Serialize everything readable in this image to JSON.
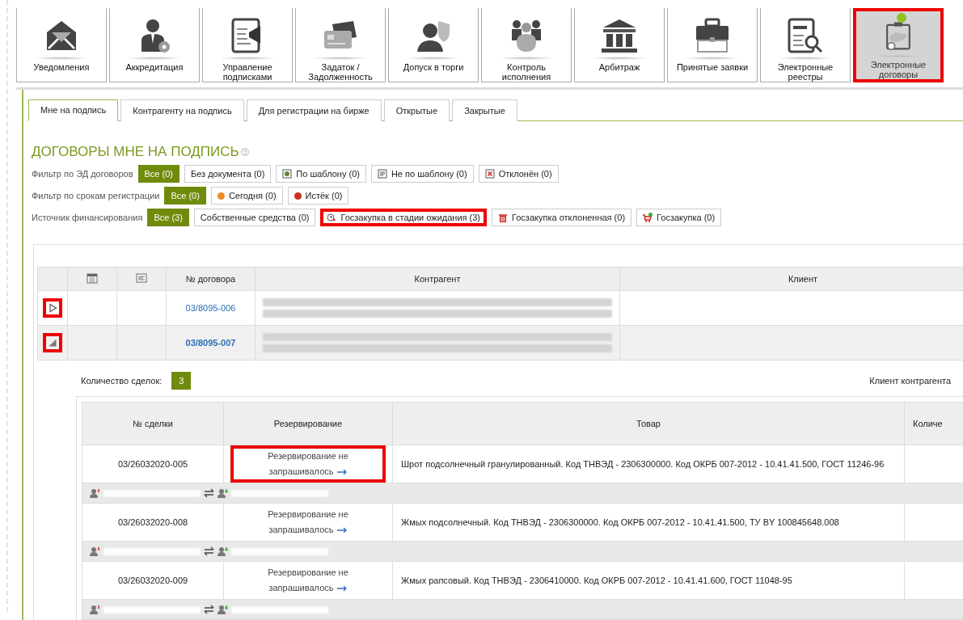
{
  "nav": [
    {
      "label": "Уведомления",
      "selected": false,
      "highlighted": false
    },
    {
      "label": "Аккредитация",
      "selected": false,
      "highlighted": false
    },
    {
      "label": "Управление подписками",
      "selected": false,
      "highlighted": false
    },
    {
      "label": "Задаток / Задолженность",
      "selected": false,
      "highlighted": false
    },
    {
      "label": "Допуск в торги",
      "selected": false,
      "highlighted": false
    },
    {
      "label": "Контроль исполнения",
      "selected": false,
      "highlighted": false
    },
    {
      "label": "Арбитраж",
      "selected": false,
      "highlighted": false
    },
    {
      "label": "Принятые заявки",
      "selected": false,
      "highlighted": false
    },
    {
      "label": "Электронные реестры",
      "selected": false,
      "highlighted": false
    },
    {
      "label": "Электронные договоры",
      "selected": true,
      "highlighted": true
    }
  ],
  "tabs": [
    {
      "label": "Мне на подпись",
      "selected": true
    },
    {
      "label": "Контрагенту на подпись",
      "selected": false
    },
    {
      "label": "Для регистрации на бирже",
      "selected": false
    },
    {
      "label": "Открытые",
      "selected": false
    },
    {
      "label": "Закрытые",
      "selected": false
    }
  ],
  "heading": "ДОГОВОРЫ МНЕ НА ПОДПИСЬ",
  "filters": [
    {
      "label": "Фильтр по ЭД договоров",
      "options": [
        {
          "label": "Все (0)",
          "selected": true,
          "kind": "plain",
          "highlighted": false
        },
        {
          "label": "Без документа (0)",
          "selected": false,
          "kind": "plain",
          "highlighted": false
        },
        {
          "label": "По шаблону (0)",
          "selected": false,
          "kind": "template",
          "highlighted": false
        },
        {
          "label": "Не по шаблону (0)",
          "selected": false,
          "kind": "document",
          "highlighted": false
        },
        {
          "label": "Отклонён (0)",
          "selected": false,
          "kind": "rejected",
          "highlighted": false
        }
      ]
    },
    {
      "label": "Фильтр по срокам регистрации",
      "options": [
        {
          "label": "Все (0)",
          "selected": true,
          "kind": "plain",
          "highlighted": false
        },
        {
          "label": "Сегодня (0)",
          "selected": false,
          "kind": "status",
          "color": "#f08a24",
          "highlighted": false
        },
        {
          "label": "Истёк (0)",
          "selected": false,
          "kind": "status",
          "color": "#c9341e",
          "highlighted": false
        }
      ]
    },
    {
      "label": "Источник финансирования",
      "options": [
        {
          "label": "Все (3)",
          "selected": true,
          "kind": "plain",
          "highlighted": false
        },
        {
          "label": "Собственные средства (0)",
          "selected": false,
          "kind": "plain",
          "highlighted": false
        },
        {
          "label": "Госзакупка в стадии ожидания (3)",
          "selected": false,
          "kind": "pending",
          "highlighted": true
        },
        {
          "label": "Госзакупка отклоненная (0)",
          "selected": false,
          "kind": "declined",
          "highlighted": false
        },
        {
          "label": "Госзакупка (0)",
          "selected": false,
          "kind": "purchase",
          "highlighted": false
        }
      ]
    }
  ],
  "contracts": {
    "columns": [
      {
        "kind": "blank"
      },
      {
        "kind": "calendar"
      },
      {
        "kind": "doc"
      },
      {
        "kind": "text",
        "label": "№ договора"
      },
      {
        "kind": "text",
        "label": "Контрагент"
      },
      {
        "kind": "text",
        "label": "Клиент"
      }
    ],
    "rows": [
      {
        "number": "03/8095-006",
        "expanded": false,
        "highlighted": true
      },
      {
        "number": "03/8095-007",
        "expanded": true,
        "highlighted": true
      }
    ]
  },
  "deals": {
    "count_label": "Количество сделок:",
    "count": "3",
    "client_label": "Клиент контрагента",
    "columns": [
      "№ сделки",
      "Резервирование",
      "Товар",
      "Количе"
    ],
    "rows": [
      {
        "number": "03/26032020-005",
        "reservation": "Резервирование не запрашивалось",
        "highlighted": true,
        "product": "Шрот подсолнечный гранулированный. Код ТНВЭД - 2306300000. Код ОКРБ 007-2012 - 10.41.41.500, ГОСТ 11246-96"
      },
      {
        "number": "03/26032020-008",
        "reservation": "Резервирование не запрашивалось",
        "highlighted": false,
        "product": "Жмых подсолнечный. Код ТНВЭД - 2306300000. Код ОКРБ 007-2012 - 10.41.41.500, ТУ BY 100845648.008"
      },
      {
        "number": "03/26032020-009",
        "reservation": "Резервирование не запрашивалось",
        "highlighted": false,
        "product": "Жмых рапсовый. Код ТНВЭД - 2306410000. Код ОКРБ 007-2012 - 10.41.41.600, ГОСТ 11048-95"
      }
    ]
  }
}
